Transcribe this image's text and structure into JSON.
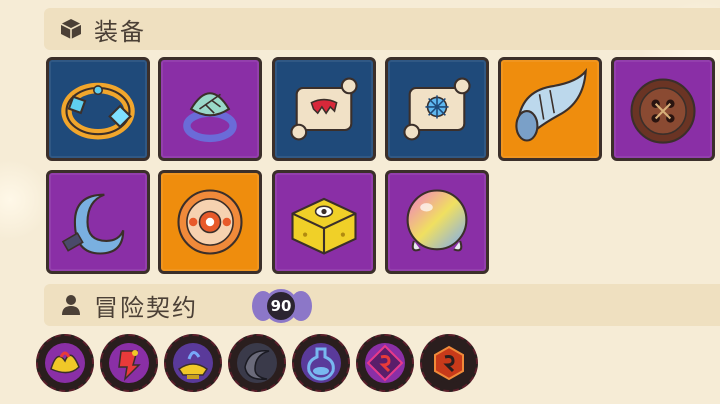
{
  "equipment": {
    "title": "装备",
    "icon": "box-icon",
    "items": [
      {
        "name": "gold-bracelet-icon",
        "rarity_color": "#1f4a7a"
      },
      {
        "name": "leaf-ring-icon",
        "rarity_color": "#8a2fa6"
      },
      {
        "name": "scroll-red-icon",
        "rarity_color": "#1f4a7a"
      },
      {
        "name": "scroll-blue-icon",
        "rarity_color": "#1f4a7a"
      },
      {
        "name": "horn-icon",
        "rarity_color": "#ef8d0d"
      },
      {
        "name": "button-icon",
        "rarity_color": "#8a2fa6"
      },
      {
        "name": "hook-icon",
        "rarity_color": "#8a2fa6"
      },
      {
        "name": "eye-disc-icon",
        "rarity_color": "#ef8d0d"
      },
      {
        "name": "gold-box-icon",
        "rarity_color": "#8a2fa6"
      },
      {
        "name": "rainbow-orb-icon",
        "rarity_color": "#8a2fa6"
      }
    ]
  },
  "contracts": {
    "title": "冒险契约",
    "icon": "person-icon",
    "level": "90",
    "items": [
      "fire-wing-contract-icon",
      "red-rune-contract-icon",
      "lamp-contract-icon",
      "crescent-contract-icon",
      "blue-bottle-contract-icon",
      "purple-rune-contract-icon",
      "red-hex-contract-icon"
    ]
  }
}
